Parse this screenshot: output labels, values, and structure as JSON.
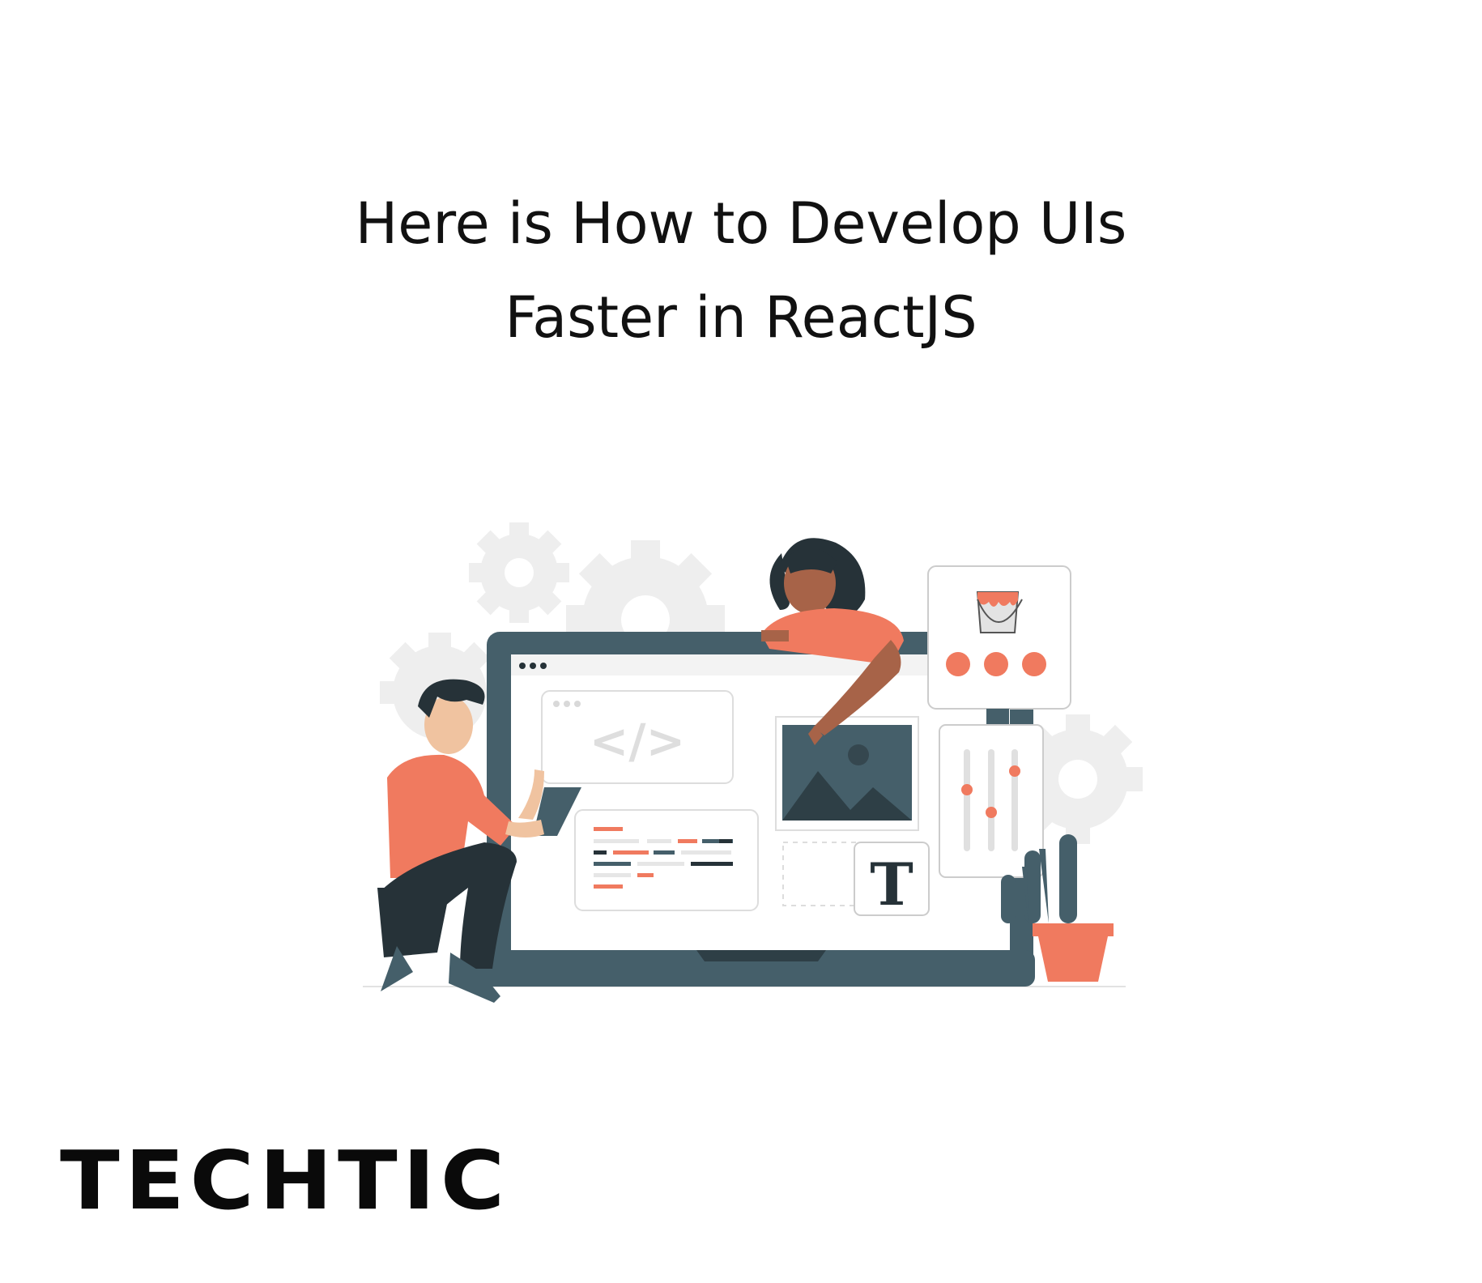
{
  "headline": {
    "line1": "Here is How to Develop UIs",
    "line2": "Faster in ReactJS"
  },
  "illustration": {
    "code_symbol": "</>",
    "text_tool_glyph": "T"
  },
  "brand": {
    "logo_text": "TECHTIC"
  },
  "colors": {
    "accent": "#f07a5f",
    "dark_slate": "#455f6a",
    "gear_gray": "#ededed",
    "text": "#111111"
  }
}
